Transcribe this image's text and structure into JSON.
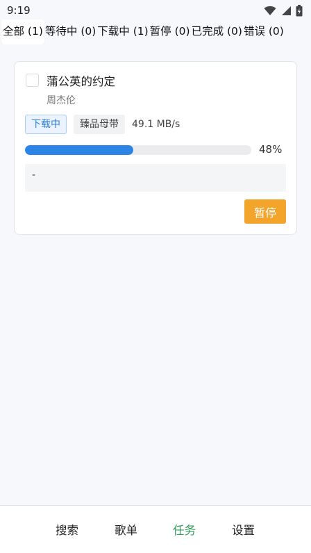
{
  "status_bar": {
    "time": "9:19",
    "icons": [
      "wifi-icon",
      "signal-icon",
      "battery-icon"
    ]
  },
  "tabs": [
    {
      "label": "全部 (1)",
      "active": true
    },
    {
      "label": "等待中 (0)",
      "active": false
    },
    {
      "label": "下载中 (1)",
      "active": false
    },
    {
      "label": "暂停 (0)",
      "active": false
    },
    {
      "label": "已完成 (0)",
      "active": false
    },
    {
      "label": "错误 (0)",
      "active": false
    }
  ],
  "task": {
    "title": "蒲公英的约定",
    "artist": "周杰伦",
    "status": "下载中",
    "quality": "臻品母带",
    "speed": "49.1 MB/s",
    "progress_percent": 48,
    "progress_label": "48%",
    "log": "-",
    "pause_label": "暂停"
  },
  "bottom_nav": [
    {
      "label": "搜索",
      "active": false
    },
    {
      "label": "歌单",
      "active": false
    },
    {
      "label": "任务",
      "active": true
    },
    {
      "label": "设置",
      "active": false
    }
  ],
  "colors": {
    "accent_blue": "#2c84e6",
    "pause_orange": "#f2a52a",
    "nav_active_green": "#2f9a5a"
  }
}
